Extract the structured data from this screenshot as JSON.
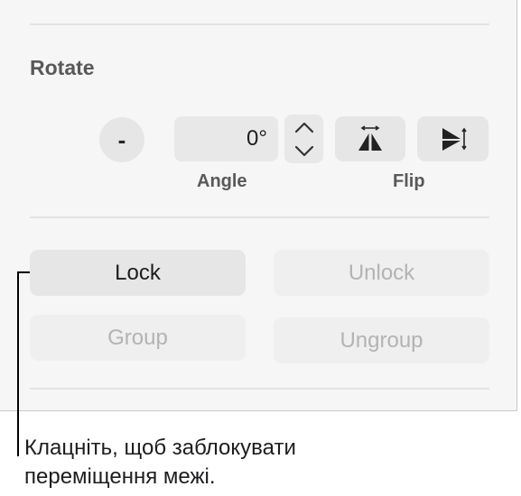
{
  "rotate": {
    "title": "Rotate",
    "minus_label": "-",
    "angle_value": "0°",
    "angle_label": "Angle",
    "flip_label": "Flip"
  },
  "buttons": {
    "lock": "Lock",
    "unlock": "Unlock",
    "group": "Group",
    "ungroup": "Ungroup"
  },
  "callout": {
    "line1": "Клацніть, щоб заблокувати",
    "line2": "переміщення межі."
  },
  "icons": {
    "stepper_up": "chevron-up-icon",
    "stepper_down": "chevron-down-icon",
    "flip_horizontal": "flip-horizontal-icon",
    "flip_vertical": "flip-vertical-icon"
  },
  "colors": {
    "panel_bg": "#f6f6f6",
    "button_bg": "#e6e6e6",
    "disabled_text": "#b3b3b3",
    "section_text": "#595959"
  }
}
